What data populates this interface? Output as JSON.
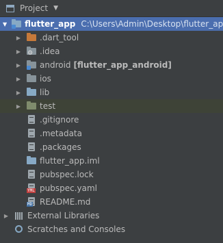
{
  "header": {
    "title": "Project",
    "caret": "▼"
  },
  "root": {
    "name": "flutter_app",
    "path": "C:\\Users\\Admin\\Desktop\\flutter_app"
  },
  "items": [
    {
      "label": ".dart_tool",
      "extra": ""
    },
    {
      "label": ".idea",
      "extra": ""
    },
    {
      "label": "android",
      "extra": "[flutter_app_android]"
    },
    {
      "label": "ios",
      "extra": ""
    },
    {
      "label": "lib",
      "extra": ""
    },
    {
      "label": "test",
      "extra": ""
    },
    {
      "label": ".gitignore"
    },
    {
      "label": ".metadata"
    },
    {
      "label": ".packages"
    },
    {
      "label": "flutter_app.iml"
    },
    {
      "label": "pubspec.lock"
    },
    {
      "label": "pubspec.yaml"
    },
    {
      "label": "README.md"
    }
  ],
  "bottom": {
    "external_libraries": "External Libraries",
    "scratches": "Scratches and Consoles"
  },
  "badges": {
    "yml": "YML",
    "md": "MD"
  },
  "icons": {
    "expanded": "▼",
    "collapsed": "▶"
  }
}
